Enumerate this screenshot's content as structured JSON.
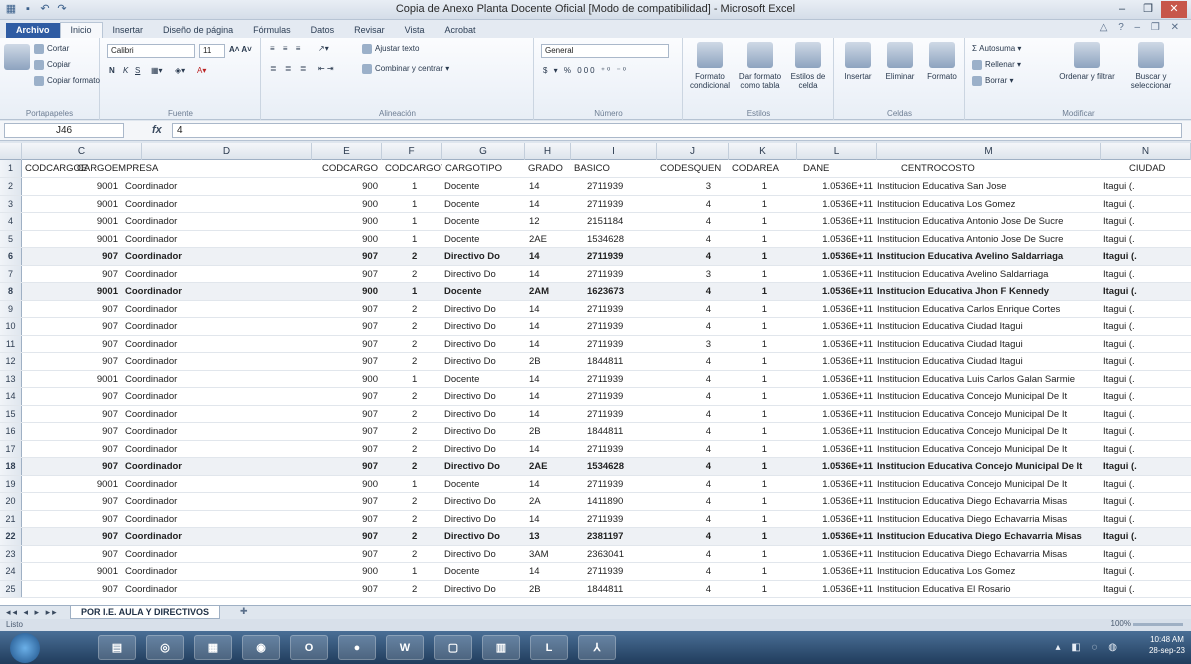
{
  "window": {
    "title": "Copia de Anexo Planta Docente Oficial [Modo de compatibilidad] - Microsoft Excel"
  },
  "tabs": [
    "Archivo",
    "Inicio",
    "Insertar",
    "Diseño de página",
    "Fórmulas",
    "Datos",
    "Revisar",
    "Vista",
    "Acrobat"
  ],
  "ribbon": {
    "clipboard": {
      "cut": "Cortar",
      "copy": "Copiar",
      "format_painter": "Copiar formato",
      "label": "Portapapeles"
    },
    "font": {
      "name": "Calibri",
      "size": "11",
      "label": "Fuente"
    },
    "alignment": {
      "wrap": "Ajustar texto",
      "merge": "Combinar y centrar",
      "label": "Alineación"
    },
    "number": {
      "format": "General",
      "label": "Número"
    },
    "styles": {
      "conditional": "Formato condicional",
      "table": "Dar formato como tabla",
      "cell_styles": "Estilos de celda",
      "label": "Estilos"
    },
    "cells": {
      "insert": "Insertar",
      "delete": "Eliminar",
      "format": "Formato",
      "label": "Celdas"
    },
    "editing": {
      "autosum": "Autosuma",
      "fill": "Rellenar",
      "clear": "Borrar",
      "sort": "Ordenar y filtrar",
      "find": "Buscar y seleccionar",
      "label": "Modificar"
    }
  },
  "formula_bar": {
    "name_box": "J46",
    "value": "4"
  },
  "columns": [
    "C",
    "D",
    "E",
    "F",
    "G",
    "H",
    "I",
    "J",
    "K",
    "L",
    "M",
    "N"
  ],
  "header_row": [
    "CODCARGOE",
    "CARGOEMPRESA",
    "CODCARGO",
    "CODCARGOT",
    "CARGOTIPO",
    "GRADO",
    "BASICO",
    "CODESQUEN",
    "CODAREA",
    "DANE",
    "CENTROCOSTO",
    "CIUDAD"
  ],
  "rows": [
    {
      "n": "2",
      "c": "9001",
      "d": "Coordinador",
      "e": "900",
      "f": "1",
      "g": "Docente",
      "h": "14",
      "i": "2711939",
      "j": "3",
      "k": "1",
      "l": "1.0536E+11",
      "m": "Institucion Educativa San Jose",
      "city": "Itagui (."
    },
    {
      "n": "3",
      "c": "9001",
      "d": "Coordinador",
      "e": "900",
      "f": "1",
      "g": "Docente",
      "h": "14",
      "i": "2711939",
      "j": "4",
      "k": "1",
      "l": "1.0536E+11",
      "m": "Institucion Educativa Los Gomez",
      "city": "Itagui (."
    },
    {
      "n": "4",
      "c": "9001",
      "d": "Coordinador",
      "e": "900",
      "f": "1",
      "g": "Docente",
      "h": "12",
      "i": "2151184",
      "j": "4",
      "k": "1",
      "l": "1.0536E+11",
      "m": "Institucion Educativa Antonio Jose De Sucre",
      "city": "Itagui (."
    },
    {
      "n": "5",
      "c": "9001",
      "d": "Coordinador",
      "e": "900",
      "f": "1",
      "g": "Docente",
      "h": "2AE",
      "i": "1534628",
      "j": "4",
      "k": "1",
      "l": "1.0536E+11",
      "m": "Institucion Educativa Antonio Jose De Sucre",
      "city": "Itagui (."
    },
    {
      "n": "6",
      "c": "907",
      "d": "Coordinador",
      "e": "907",
      "f": "2",
      "g": "Directivo Do",
      "h": "14",
      "i": "2711939",
      "j": "4",
      "k": "1",
      "l": "1.0536E+11",
      "m": "Institucion Educativa Avelino Saldarriaga",
      "city": "Itagui (."
    },
    {
      "n": "7",
      "c": "907",
      "d": "Coordinador",
      "e": "907",
      "f": "2",
      "g": "Directivo Do",
      "h": "14",
      "i": "2711939",
      "j": "3",
      "k": "1",
      "l": "1.0536E+11",
      "m": "Institucion Educativa Avelino Saldarriaga",
      "city": "Itagui (."
    },
    {
      "n": "8",
      "c": "9001",
      "d": "Coordinador",
      "e": "900",
      "f": "1",
      "g": "Docente",
      "h": "2AM",
      "i": "1623673",
      "j": "4",
      "k": "1",
      "l": "1.0536E+11",
      "m": "Institucion Educativa Jhon F Kennedy",
      "city": "Itagui (."
    },
    {
      "n": "9",
      "c": "907",
      "d": "Coordinador",
      "e": "907",
      "f": "2",
      "g": "Directivo Do",
      "h": "14",
      "i": "2711939",
      "j": "4",
      "k": "1",
      "l": "1.0536E+11",
      "m": "Institucion Educativa Carlos Enrique Cortes",
      "city": "Itagui (."
    },
    {
      "n": "10",
      "c": "907",
      "d": "Coordinador",
      "e": "907",
      "f": "2",
      "g": "Directivo Do",
      "h": "14",
      "i": "2711939",
      "j": "4",
      "k": "1",
      "l": "1.0536E+11",
      "m": "Institucion Educativa Ciudad Itagui",
      "city": "Itagui (."
    },
    {
      "n": "11",
      "c": "907",
      "d": "Coordinador",
      "e": "907",
      "f": "2",
      "g": "Directivo Do",
      "h": "14",
      "i": "2711939",
      "j": "3",
      "k": "1",
      "l": "1.0536E+11",
      "m": "Institucion Educativa Ciudad Itagui",
      "city": "Itagui (."
    },
    {
      "n": "12",
      "c": "907",
      "d": "Coordinador",
      "e": "907",
      "f": "2",
      "g": "Directivo Do",
      "h": "2B",
      "i": "1844811",
      "j": "4",
      "k": "1",
      "l": "1.0536E+11",
      "m": "Institucion Educativa Ciudad Itagui",
      "city": "Itagui (."
    },
    {
      "n": "13",
      "c": "9001",
      "d": "Coordinador",
      "e": "900",
      "f": "1",
      "g": "Docente",
      "h": "14",
      "i": "2711939",
      "j": "4",
      "k": "1",
      "l": "1.0536E+11",
      "m": "Institucion Educativa Luis Carlos Galan Sarmie",
      "city": "Itagui (."
    },
    {
      "n": "14",
      "c": "907",
      "d": "Coordinador",
      "e": "907",
      "f": "2",
      "g": "Directivo Do",
      "h": "14",
      "i": "2711939",
      "j": "4",
      "k": "1",
      "l": "1.0536E+11",
      "m": "Institucion Educativa Concejo Municipal De It",
      "city": "Itagui (."
    },
    {
      "n": "15",
      "c": "907",
      "d": "Coordinador",
      "e": "907",
      "f": "2",
      "g": "Directivo Do",
      "h": "14",
      "i": "2711939",
      "j": "4",
      "k": "1",
      "l": "1.0536E+11",
      "m": "Institucion Educativa Concejo Municipal De It",
      "city": "Itagui (."
    },
    {
      "n": "16",
      "c": "907",
      "d": "Coordinador",
      "e": "907",
      "f": "2",
      "g": "Directivo Do",
      "h": "2B",
      "i": "1844811",
      "j": "4",
      "k": "1",
      "l": "1.0536E+11",
      "m": "Institucion Educativa Concejo Municipal De It",
      "city": "Itagui (."
    },
    {
      "n": "17",
      "c": "907",
      "d": "Coordinador",
      "e": "907",
      "f": "2",
      "g": "Directivo Do",
      "h": "14",
      "i": "2711939",
      "j": "4",
      "k": "1",
      "l": "1.0536E+11",
      "m": "Institucion Educativa Concejo Municipal De It",
      "city": "Itagui (."
    },
    {
      "n": "18",
      "c": "907",
      "d": "Coordinador",
      "e": "907",
      "f": "2",
      "g": "Directivo Do",
      "h": "2AE",
      "i": "1534628",
      "j": "4",
      "k": "1",
      "l": "1.0536E+11",
      "m": "Institucion Educativa Concejo Municipal De It",
      "city": "Itagui (."
    },
    {
      "n": "19",
      "c": "9001",
      "d": "Coordinador",
      "e": "900",
      "f": "1",
      "g": "Docente",
      "h": "14",
      "i": "2711939",
      "j": "4",
      "k": "1",
      "l": "1.0536E+11",
      "m": "Institucion Educativa Concejo Municipal De It",
      "city": "Itagui (."
    },
    {
      "n": "20",
      "c": "907",
      "d": "Coordinador",
      "e": "907",
      "f": "2",
      "g": "Directivo Do",
      "h": "2A",
      "i": "1411890",
      "j": "4",
      "k": "1",
      "l": "1.0536E+11",
      "m": "Institucion Educativa Diego Echavarria Misas",
      "city": "Itagui (."
    },
    {
      "n": "21",
      "c": "907",
      "d": "Coordinador",
      "e": "907",
      "f": "2",
      "g": "Directivo Do",
      "h": "14",
      "i": "2711939",
      "j": "4",
      "k": "1",
      "l": "1.0536E+11",
      "m": "Institucion Educativa Diego Echavarria Misas",
      "city": "Itagui (."
    },
    {
      "n": "22",
      "c": "907",
      "d": "Coordinador",
      "e": "907",
      "f": "2",
      "g": "Directivo Do",
      "h": "13",
      "i": "2381197",
      "j": "4",
      "k": "1",
      "l": "1.0536E+11",
      "m": "Institucion Educativa Diego Echavarria Misas",
      "city": "Itagui (."
    },
    {
      "n": "23",
      "c": "907",
      "d": "Coordinador",
      "e": "907",
      "f": "2",
      "g": "Directivo Do",
      "h": "3AM",
      "i": "2363041",
      "j": "4",
      "k": "1",
      "l": "1.0536E+11",
      "m": "Institucion Educativa Diego Echavarria Misas",
      "city": "Itagui (."
    },
    {
      "n": "24",
      "c": "9001",
      "d": "Coordinador",
      "e": "900",
      "f": "1",
      "g": "Docente",
      "h": "14",
      "i": "2711939",
      "j": "4",
      "k": "1",
      "l": "1.0536E+11",
      "m": "Institucion Educativa Los Gomez",
      "city": "Itagui (."
    },
    {
      "n": "25",
      "c": "907",
      "d": "Coordinador",
      "e": "907",
      "f": "2",
      "g": "Directivo Do",
      "h": "2B",
      "i": "1844811",
      "j": "4",
      "k": "1",
      "l": "1.0536E+11",
      "m": "Institucion Educativa El Rosario",
      "city": "Itagui (."
    }
  ],
  "sheet_tabs": [
    "POR I.E. AULA Y DIRECTIVOS"
  ],
  "status": {
    "ready": "Listo",
    "zoom": "100%"
  },
  "taskbar": {
    "time": "10:48 AM",
    "date": "28-sep-23",
    "word": "W",
    "outlook": "O"
  }
}
